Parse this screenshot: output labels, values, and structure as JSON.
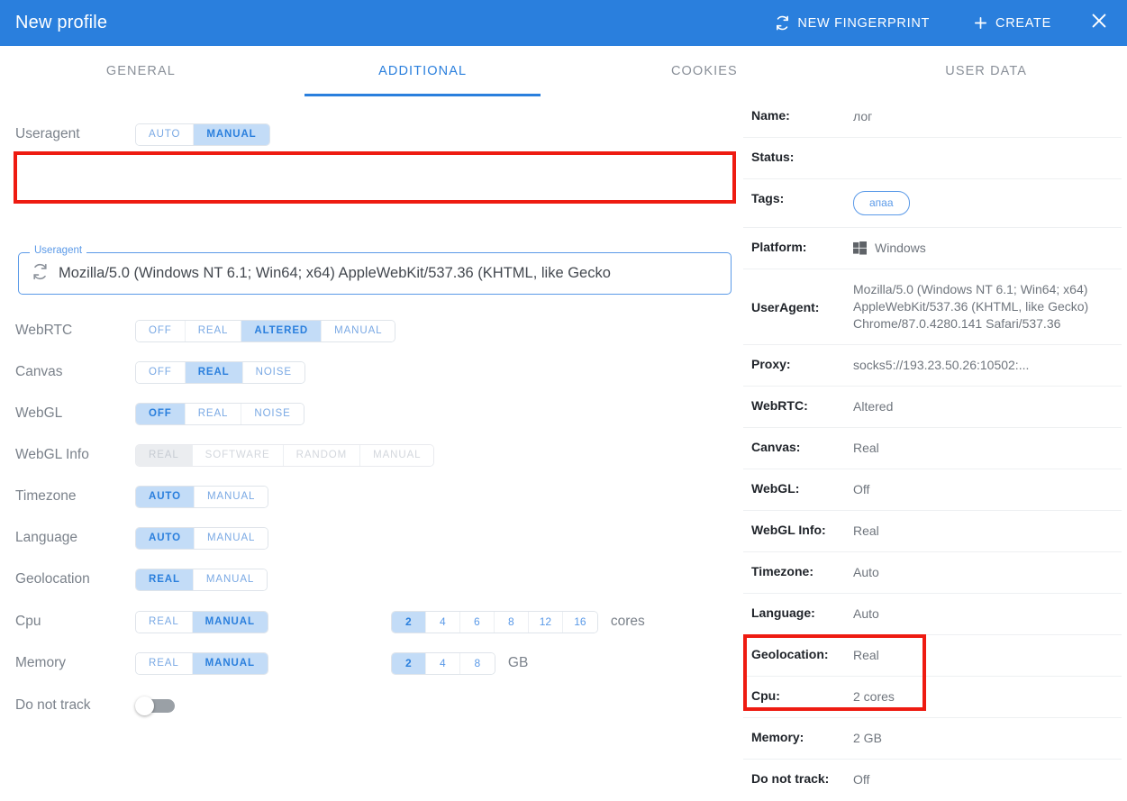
{
  "window": {
    "title": "New profile",
    "actions": {
      "new_fingerprint": "NEW FINGERPRINT",
      "create": "CREATE",
      "close": "×"
    },
    "icons": {
      "refresh": "refresh-icon",
      "plus": "plus-icon",
      "close": "close-icon"
    }
  },
  "tabs": [
    {
      "label": "GENERAL",
      "active": false
    },
    {
      "label": "ADDITIONAL",
      "active": true
    },
    {
      "label": "COOKIES",
      "active": false
    },
    {
      "label": "USER DATA",
      "active": false
    }
  ],
  "settings": {
    "useragent": {
      "label": "Useragent",
      "options": [
        "AUTO",
        "MANUAL"
      ],
      "selected": "MANUAL",
      "field_legend": "Useragent",
      "field_value": "Mozilla/5.0 (Windows NT 6.1; Win64; x64) AppleWebKit/537.36 (KHTML, like Gecko"
    },
    "webrtc": {
      "label": "WebRTC",
      "options": [
        "OFF",
        "REAL",
        "ALTERED",
        "MANUAL"
      ],
      "selected": "ALTERED"
    },
    "canvas": {
      "label": "Canvas",
      "options": [
        "OFF",
        "REAL",
        "NOISE"
      ],
      "selected": "REAL"
    },
    "webgl": {
      "label": "WebGL",
      "options": [
        "OFF",
        "REAL",
        "NOISE"
      ],
      "selected": "OFF"
    },
    "webgl_info": {
      "label": "WebGL Info",
      "options": [
        "REAL",
        "SOFTWARE",
        "RANDOM",
        "MANUAL"
      ],
      "selected": "REAL",
      "disabled": true
    },
    "timezone": {
      "label": "Timezone",
      "options": [
        "AUTO",
        "MANUAL"
      ],
      "selected": "AUTO"
    },
    "language": {
      "label": "Language",
      "options": [
        "AUTO",
        "MANUAL"
      ],
      "selected": "AUTO"
    },
    "geolocation": {
      "label": "Geolocation",
      "options": [
        "REAL",
        "MANUAL"
      ],
      "selected": "REAL"
    },
    "cpu": {
      "label": "Cpu",
      "options": [
        "REAL",
        "MANUAL"
      ],
      "selected": "MANUAL",
      "values": [
        "2",
        "4",
        "6",
        "8",
        "12",
        "16"
      ],
      "value_selected": "2",
      "unit": "cores"
    },
    "memory": {
      "label": "Memory",
      "options": [
        "REAL",
        "MANUAL"
      ],
      "selected": "MANUAL",
      "values": [
        "2",
        "4",
        "8"
      ],
      "value_selected": "2",
      "unit": "GB"
    },
    "do_not_track": {
      "label": "Do not track",
      "enabled": false
    }
  },
  "summary": [
    {
      "key": "Name:",
      "value": "лог",
      "type": "text"
    },
    {
      "key": "Status:",
      "value": "",
      "type": "text"
    },
    {
      "key": "Tags:",
      "value": "апаа",
      "type": "tag"
    },
    {
      "key": "Platform:",
      "value": "Windows",
      "type": "platform"
    },
    {
      "key": "UserAgent:",
      "value": "Mozilla/5.0 (Windows NT 6.1; Win64; x64) AppleWebKit/537.36 (KHTML, like Gecko) Chrome/87.0.4280.141 Safari/537.36",
      "type": "multiline"
    },
    {
      "key": "Proxy:",
      "value": "socks5://193.23.50.26:10502:...",
      "type": "text"
    },
    {
      "key": "WebRTC:",
      "value": "Altered",
      "type": "text"
    },
    {
      "key": "Canvas:",
      "value": "Real",
      "type": "text"
    },
    {
      "key": "WebGL:",
      "value": "Off",
      "type": "text"
    },
    {
      "key": "WebGL Info:",
      "value": "Real",
      "type": "text"
    },
    {
      "key": "Timezone:",
      "value": "Auto",
      "type": "text"
    },
    {
      "key": "Language:",
      "value": "Auto",
      "type": "text"
    },
    {
      "key": "Geolocation:",
      "value": "Real",
      "type": "text"
    },
    {
      "key": "Cpu:",
      "value": "2 cores",
      "type": "text"
    },
    {
      "key": "Memory:",
      "value": "2 GB",
      "type": "text"
    },
    {
      "key": "Do not track:",
      "value": "Off",
      "type": "text"
    }
  ],
  "annotations": {
    "useragent_highlight": "red-highlight-box",
    "cpu_memory_highlight": "red-highlight-box"
  },
  "colors": {
    "header_blue": "#2a7fdd",
    "accent_blue": "#5b9ae8",
    "selected_segment": "#c3dcf7",
    "annotation_red": "#ee1b11",
    "label_grey": "#7b828b"
  }
}
